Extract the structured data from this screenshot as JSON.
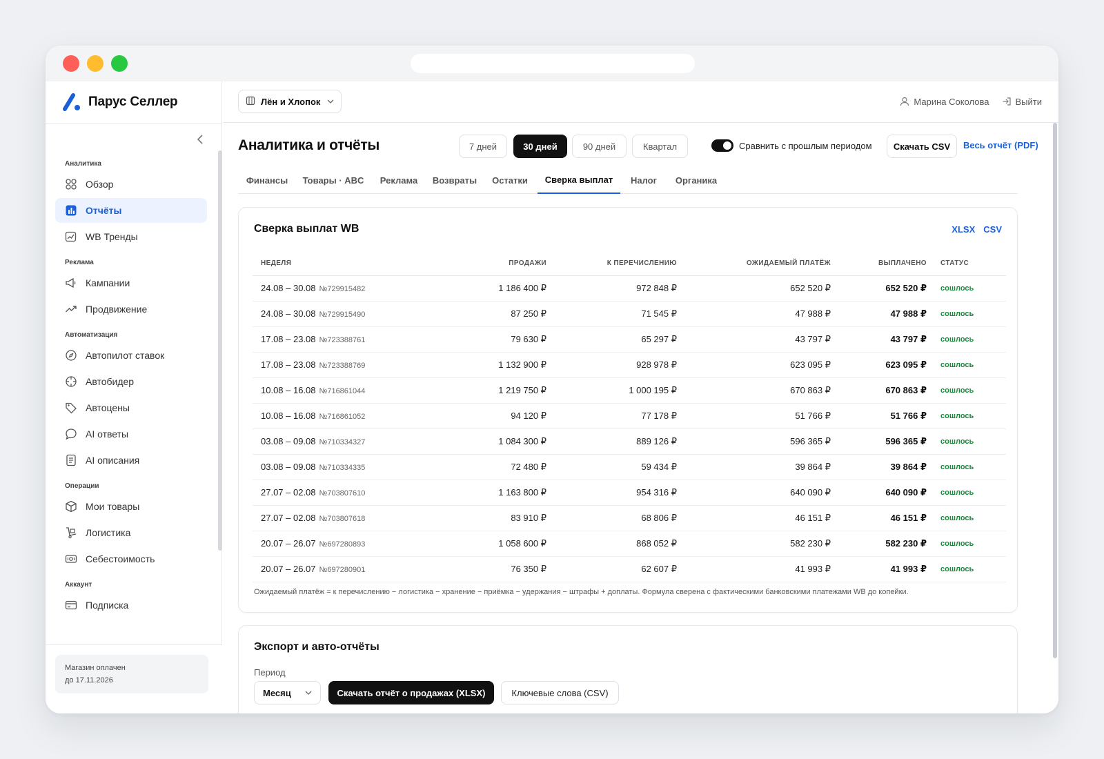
{
  "brand": {
    "name": "Парус Селлер"
  },
  "store": {
    "name": "Лён и Хлопок"
  },
  "user": {
    "name": "Марина Соколова",
    "logout": "Выйти"
  },
  "sidebar": {
    "groups": [
      {
        "title": "Аналитика",
        "items": [
          {
            "label": "Обзор",
            "icon": "grid-icon"
          },
          {
            "label": "Отчёты",
            "icon": "bar-chart-icon",
            "active": true
          },
          {
            "label": "WB Тренды",
            "icon": "trend-card-icon"
          }
        ]
      },
      {
        "title": "Реклама",
        "items": [
          {
            "label": "Кампании",
            "icon": "megaphone-icon"
          },
          {
            "label": "Продвижение",
            "icon": "trending-up-icon"
          }
        ]
      },
      {
        "title": "Автоматизация",
        "items": [
          {
            "label": "Автопилот ставок",
            "icon": "compass-icon"
          },
          {
            "label": "Автобидер",
            "icon": "crosshair-icon"
          },
          {
            "label": "Автоцены",
            "icon": "tag-icon"
          },
          {
            "label": "AI ответы",
            "icon": "chat-bubble-icon"
          },
          {
            "label": "AI описания",
            "icon": "document-icon"
          }
        ]
      },
      {
        "title": "Операции",
        "items": [
          {
            "label": "Мои товары",
            "icon": "box-icon"
          },
          {
            "label": "Логистика",
            "icon": "dolly-icon"
          },
          {
            "label": "Себестоимость",
            "icon": "cash-icon"
          }
        ]
      },
      {
        "title": "Аккаунт",
        "items": [
          {
            "label": "Подписка",
            "icon": "credit-card-icon"
          }
        ]
      }
    ],
    "footer": {
      "line1": "Магазин оплачен",
      "line2": "до 17.11.2026"
    }
  },
  "page": {
    "title": "Аналитика и отчёты",
    "periods": [
      "7 дней",
      "30 дней",
      "90 дней",
      "Квартал"
    ],
    "active_period": "30 дней",
    "compare_label": "Сравнить с прошлым периодом",
    "compare_on": true,
    "download_csv": "Скачать CSV",
    "full_report": "Весь отчёт (PDF)",
    "tabs": [
      "Финансы",
      "Товары · ABC",
      "Реклама",
      "Возвраты",
      "Остатки",
      "Сверка выплат",
      "Налог",
      "Органика"
    ],
    "active_tab": "Сверка выплат"
  },
  "payouts": {
    "title": "Сверка выплат WB",
    "export_xlsx": "XLSX",
    "export_csv": "CSV",
    "columns": [
      "НЕДЕЛЯ",
      "ПРОДАЖИ",
      "К ПЕРЕЧИСЛЕНИЮ",
      "ОЖИДАЕМЫЙ ПЛАТЁЖ",
      "ВЫПЛАЧЕНО",
      "СТАТУС"
    ],
    "rows": [
      {
        "week": "24.08 – 30.08",
        "num": "№729915482",
        "sales": "1 186 400 ₽",
        "transfer": "972 848 ₽",
        "expected": "652 520 ₽",
        "paid": "652 520 ₽",
        "status": "сошлось"
      },
      {
        "week": "24.08 – 30.08",
        "num": "№729915490",
        "sales": "87 250 ₽",
        "transfer": "71 545 ₽",
        "expected": "47 988 ₽",
        "paid": "47 988 ₽",
        "status": "сошлось"
      },
      {
        "week": "17.08 – 23.08",
        "num": "№723388761",
        "sales": "79 630 ₽",
        "transfer": "65 297 ₽",
        "expected": "43 797 ₽",
        "paid": "43 797 ₽",
        "status": "сошлось"
      },
      {
        "week": "17.08 – 23.08",
        "num": "№723388769",
        "sales": "1 132 900 ₽",
        "transfer": "928 978 ₽",
        "expected": "623 095 ₽",
        "paid": "623 095 ₽",
        "status": "сошлось"
      },
      {
        "week": "10.08 – 16.08",
        "num": "№716861044",
        "sales": "1 219 750 ₽",
        "transfer": "1 000 195 ₽",
        "expected": "670 863 ₽",
        "paid": "670 863 ₽",
        "status": "сошлось"
      },
      {
        "week": "10.08 – 16.08",
        "num": "№716861052",
        "sales": "94 120 ₽",
        "transfer": "77 178 ₽",
        "expected": "51 766 ₽",
        "paid": "51 766 ₽",
        "status": "сошлось"
      },
      {
        "week": "03.08 – 09.08",
        "num": "№710334327",
        "sales": "1 084 300 ₽",
        "transfer": "889 126 ₽",
        "expected": "596 365 ₽",
        "paid": "596 365 ₽",
        "status": "сошлось"
      },
      {
        "week": "03.08 – 09.08",
        "num": "№710334335",
        "sales": "72 480 ₽",
        "transfer": "59 434 ₽",
        "expected": "39 864 ₽",
        "paid": "39 864 ₽",
        "status": "сошлось"
      },
      {
        "week": "27.07 – 02.08",
        "num": "№703807610",
        "sales": "1 163 800 ₽",
        "transfer": "954 316 ₽",
        "expected": "640 090 ₽",
        "paid": "640 090 ₽",
        "status": "сошлось"
      },
      {
        "week": "27.07 – 02.08",
        "num": "№703807618",
        "sales": "83 910 ₽",
        "transfer": "68 806 ₽",
        "expected": "46 151 ₽",
        "paid": "46 151 ₽",
        "status": "сошлось"
      },
      {
        "week": "20.07 – 26.07",
        "num": "№697280893",
        "sales": "1 058 600 ₽",
        "transfer": "868 052 ₽",
        "expected": "582 230 ₽",
        "paid": "582 230 ₽",
        "status": "сошлось"
      },
      {
        "week": "20.07 – 26.07",
        "num": "№697280901",
        "sales": "76 350 ₽",
        "transfer": "62 607 ₽",
        "expected": "41 993 ₽",
        "paid": "41 993 ₽",
        "status": "сошлось"
      }
    ],
    "footnote": "Ожидаемый платёж = к перечислению − логистика − хранение − приёмка − удержания − штрафы + доплаты. Формула сверена с фактическими банковскими платежами WB до копейки."
  },
  "export": {
    "title": "Экспорт и авто-отчёты",
    "period_label": "Период",
    "period_value": "Месяц",
    "download_sales": "Скачать отчёт о продажах (XLSX)",
    "keywords": "Ключевые слова (CSV)"
  },
  "colors": {
    "accent": "#1b5fd8",
    "success": "#1a8a3c",
    "dark": "#111111",
    "sidebar_active_bg": "#ecf2ff"
  }
}
